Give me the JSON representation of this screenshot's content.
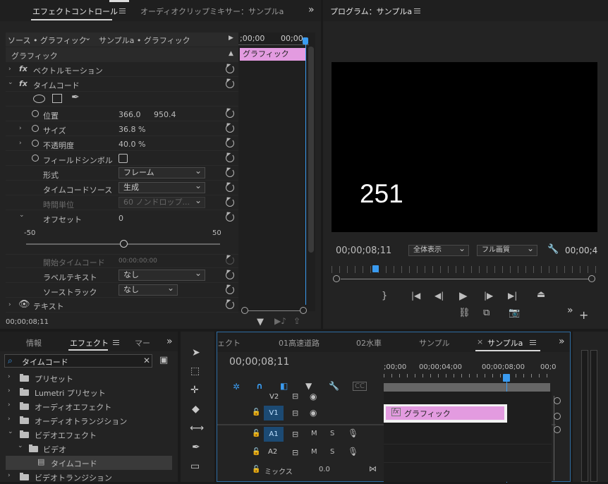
{
  "effect_controls": {
    "tab_label": "エフェクトコントロール",
    "tab2_label": "オーディオクリップミキサー：サンプルa",
    "source_label": "ソース • グラフィック",
    "source_select": "サンプルa • グラフィック",
    "ruler_t0": ";00;00",
    "ruler_t1": "00;00",
    "clip_label": "グラフィック",
    "section_label": "グラフィック",
    "vector_motion": "ベクトルモーション",
    "timecode_fx": "タイムコード",
    "position_label": "位置",
    "position_x": "366.0",
    "position_y": "950.4",
    "size_label": "サイズ",
    "size_value": "36.8 %",
    "opacity_label": "不透明度",
    "opacity_value": "40.0 %",
    "field_symbol_label": "フィールドシンボル",
    "format_label": "形式",
    "format_value": "フレーム",
    "tc_source_label": "タイムコードソース",
    "tc_source_value": "生成",
    "time_unit_label": "時間単位",
    "time_unit_value": "60 ノンドロップ...",
    "offset_label": "オフセット",
    "offset_value": "0",
    "slider_min": "-50",
    "slider_max": "50",
    "start_tc_label": "開始タイムコード",
    "start_tc_value": "00:00:00:00",
    "label_text_label": "ラベルテキスト",
    "label_text_value": "なし",
    "source_track_label": "ソーストラック",
    "source_track_value": "なし",
    "text_label": "テキスト",
    "footer_time": "00;00;08;11"
  },
  "program": {
    "title": "プログラム：サンプルa",
    "overlay_number": "251",
    "current_time": "00;00;08;11",
    "zoom_value": "全体表示",
    "quality_value": "フル画質",
    "end_time": "00;00;4"
  },
  "project": {
    "tabs": [
      "情報",
      "エフェクト",
      "マー"
    ],
    "active_tab": "エフェクト",
    "search_value": "タイムコード",
    "items": [
      {
        "label": "プリセット",
        "indent": 0,
        "open": false
      },
      {
        "label": "Lumetri プリセット",
        "indent": 0,
        "open": false
      },
      {
        "label": "オーディオエフェクト",
        "indent": 0,
        "open": false
      },
      {
        "label": "オーディオトランジション",
        "indent": 0,
        "open": false
      },
      {
        "label": "ビデオエフェクト",
        "indent": 0,
        "open": true
      },
      {
        "label": "ビデオ",
        "indent": 1,
        "open": true
      },
      {
        "label": "タイムコード",
        "indent": 2,
        "open": false
      },
      {
        "label": "ビデオトランジション",
        "indent": 0,
        "open": false
      }
    ]
  },
  "timeline": {
    "tabs": [
      "ェクト",
      "01高速道路",
      "02水車",
      "サンプル",
      "サンプルa"
    ],
    "active_tab": "サンプルa",
    "current_time": "00;00;08;11",
    "ruler": [
      ";00;00",
      "00;00;04;00",
      "00;00;08;00",
      "00;0"
    ],
    "tracks": [
      {
        "name": "V2",
        "kind": "video"
      },
      {
        "name": "V1",
        "kind": "video"
      },
      {
        "name": "A1",
        "kind": "audio"
      },
      {
        "name": "A2",
        "kind": "audio"
      }
    ],
    "mix_label": "ミックス",
    "mix_value": "0.0",
    "clip_label": "グラフィック"
  },
  "colors": {
    "accent": "#3a9bf0",
    "clip": "#e39be0",
    "panel": "#232323"
  }
}
